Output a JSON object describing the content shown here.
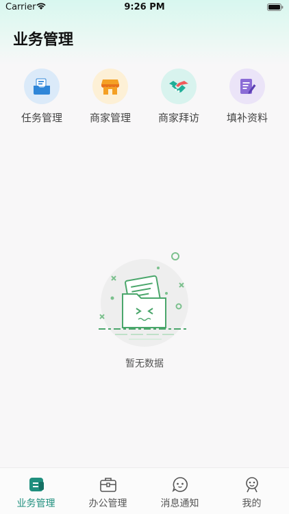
{
  "status_bar": {
    "carrier": "Carrier",
    "time": "9:26 PM"
  },
  "header": {
    "title": "业务管理"
  },
  "quick_actions": [
    {
      "label": "任务管理",
      "icon": "inbox-tray-icon",
      "bg": "#dbeaf9"
    },
    {
      "label": "商家管理",
      "icon": "storefront-icon",
      "bg": "#fdf0d6"
    },
    {
      "label": "商家拜访",
      "icon": "handshake-icon",
      "bg": "#d8f3ee"
    },
    {
      "label": "填补资料",
      "icon": "edit-document-icon",
      "bg": "#ebe4f8"
    }
  ],
  "empty_state": {
    "text": "暂无数据"
  },
  "tabbar": {
    "active_color": "#1f8f7e",
    "items": [
      {
        "label": "业务管理",
        "icon": "business-card-icon",
        "active": true
      },
      {
        "label": "办公管理",
        "icon": "briefcase-icon",
        "active": false
      },
      {
        "label": "消息通知",
        "icon": "message-face-icon",
        "active": false
      },
      {
        "label": "我的",
        "icon": "profile-icon",
        "active": false
      }
    ]
  }
}
